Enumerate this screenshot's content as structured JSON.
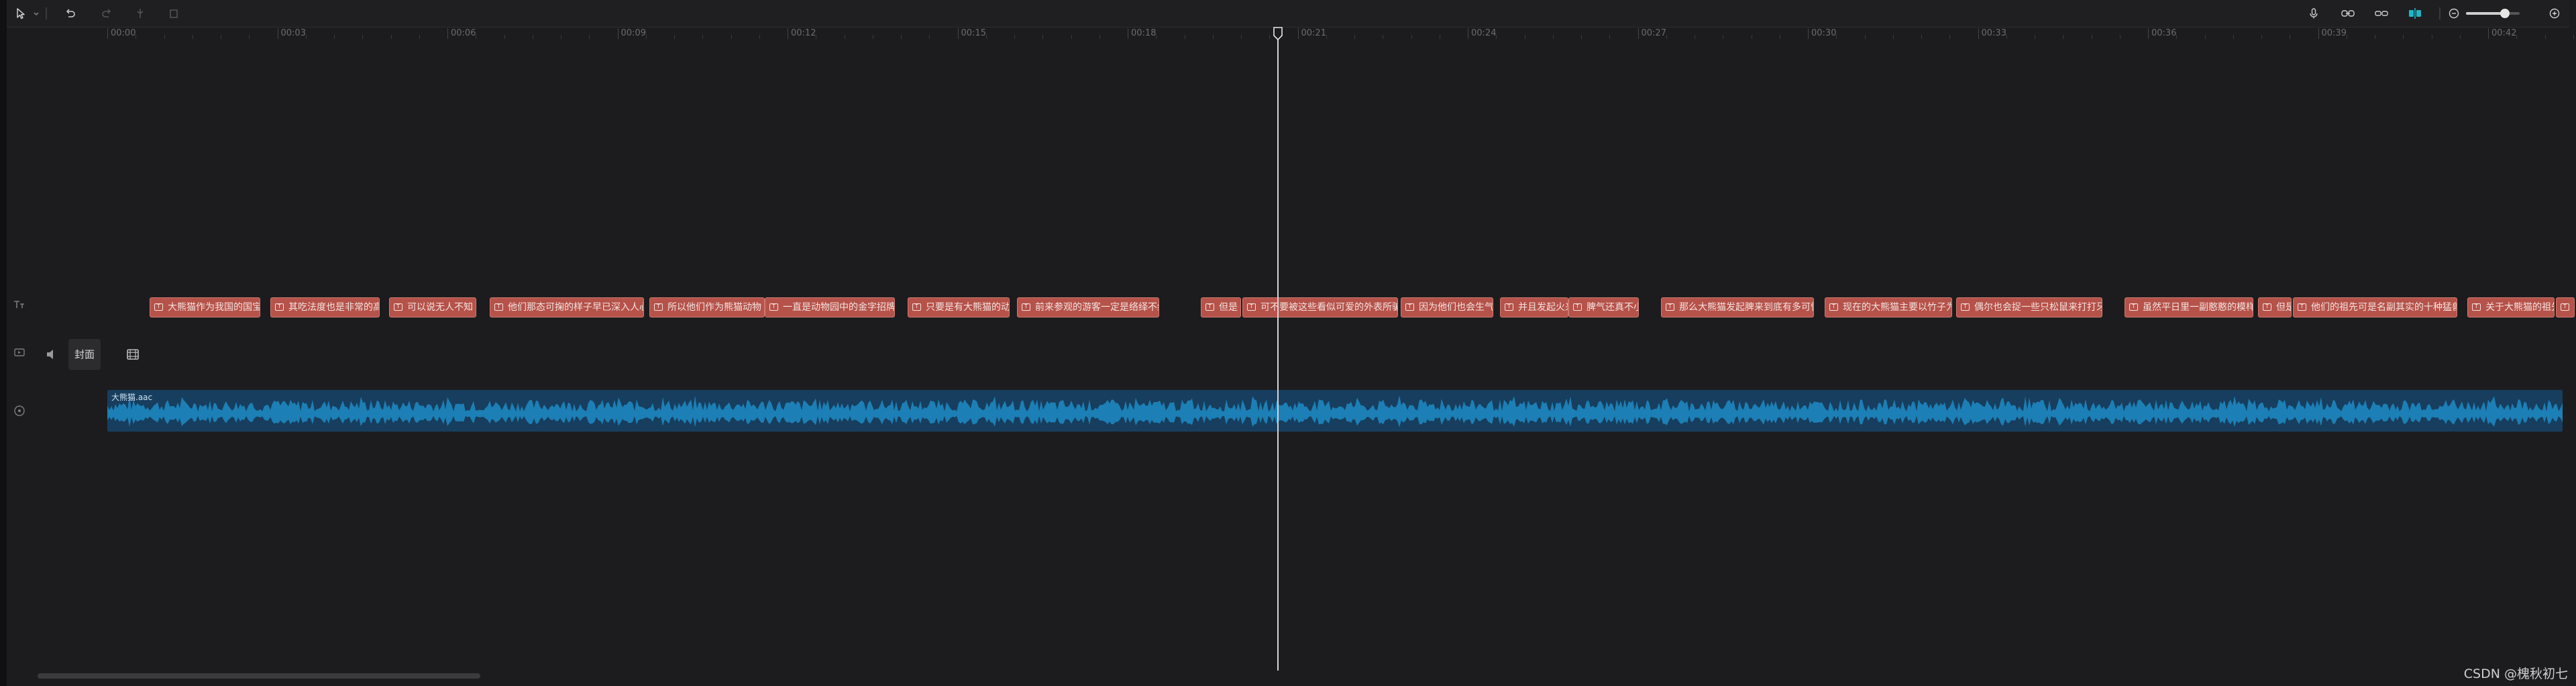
{
  "toolbar": {
    "left_icons": [
      "select-arrow-icon",
      "chevron-down-icon",
      "undo-icon",
      "redo-icon",
      "split-icon",
      "delete-icon"
    ],
    "right_icons": [
      "microphone-icon",
      "link-icon",
      "chain-icon",
      "preview-axis-icon",
      "zoom-out-icon",
      "zoom-in-icon"
    ],
    "zoom_level_fraction": 0.72,
    "accent_color": "#1fb7c6"
  },
  "ruler": {
    "labels": [
      "00:00",
      "00:03",
      "00:06",
      "00:09",
      "00:12",
      "00:15",
      "00:18",
      "00:21",
      "00:24",
      "00:27",
      "00:30",
      "00:33",
      "00:36",
      "00:39",
      "00:42"
    ]
  },
  "tracks": {
    "text_icon": "text-track-icon",
    "video_icons": [
      "video-track-icon",
      "mute-icon"
    ],
    "cover_label": "封面",
    "cover_icon": "film-icon",
    "audio_icon": "audio-track-icon"
  },
  "text_clips": [
    {
      "label": "大熊猫作为我国的国宝"
    },
    {
      "label": "其吃法度也是非常的高"
    },
    {
      "label": "可以说无人不知"
    },
    {
      "label": "他们那态可掬的样子早已深入人心"
    },
    {
      "label": "所以他们作为熊猫动物"
    },
    {
      "label": "一直是动物园中的金字招牌"
    },
    {
      "label": "只要是有大熊猫的动"
    },
    {
      "label": "前来参观的游客一定是络绎不绝"
    },
    {
      "label": "但是"
    },
    {
      "label": "可不要被这些看似可爱的外表所骗"
    },
    {
      "label": "因为他们也会生气"
    },
    {
      "label": "并且发起火来"
    },
    {
      "label": "脾气还真不小"
    },
    {
      "label": "那么大熊猫发起脾来到底有多可怕"
    },
    {
      "label": "现在的大熊猫主要以竹子为食"
    },
    {
      "label": "偶尔也会捉一些只松鼠来打打牙祭"
    },
    {
      "label": "虽然平日里一副憨憨的模样"
    },
    {
      "label": "但是"
    },
    {
      "label": "他们的祖先可是名副其实的十种猛兽"
    },
    {
      "label": "关于大熊猫的祖先"
    },
    {
      "label": "其"
    }
  ],
  "audio": {
    "name": "大熊猫.aac",
    "wave_color": "#1c7fb5"
  },
  "watermark": "CSDN @槐秋初七"
}
